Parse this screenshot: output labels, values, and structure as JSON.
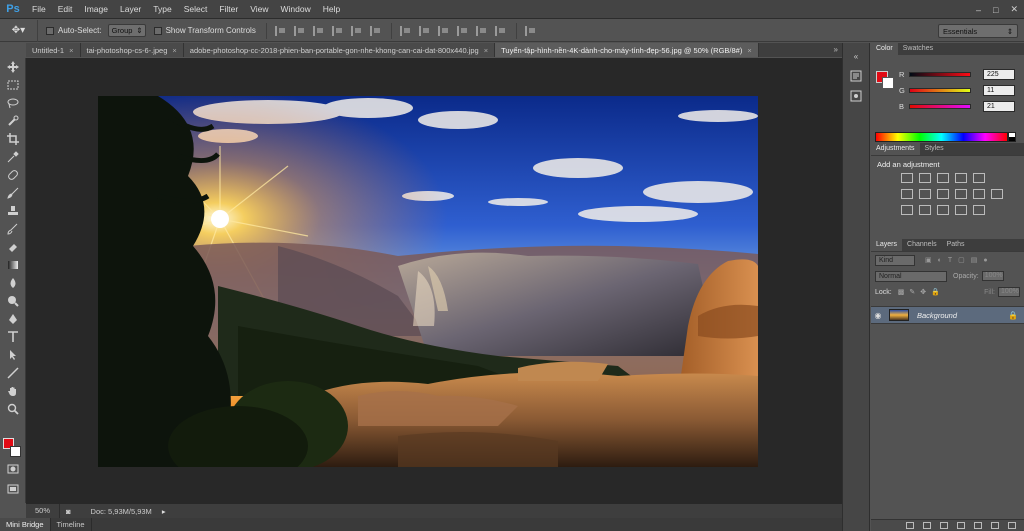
{
  "app": {
    "logo": "Ps"
  },
  "menu": [
    "File",
    "Edit",
    "Image",
    "Layer",
    "Type",
    "Select",
    "Filter",
    "View",
    "Window",
    "Help"
  ],
  "window_controls": [
    "–",
    "□",
    "✕"
  ],
  "options": {
    "auto_select_label": "Auto-Select:",
    "auto_select_value": "Group",
    "transform_label": "Show Transform Controls",
    "workspace": "Essentials"
  },
  "tabs": [
    {
      "label": "Untitled-1",
      "active": false
    },
    {
      "label": "tai-photoshop-cs-6-.jpeg",
      "active": false
    },
    {
      "label": "adobe-photoshop-cc-2018-phien-ban-portable-gon-nhe-khong-can-cai-dat-800x440.jpg",
      "active": false
    },
    {
      "label": "Tuyển-tập-hình-nền-4K-dành-cho-máy-tính-đẹp-56.jpg @ 50% (RGB/8#)",
      "active": true
    }
  ],
  "status": {
    "zoom": "50%",
    "doc": "Doc: 5,93M/5,93M"
  },
  "bottom_tabs": [
    "Mini Bridge",
    "Timeline"
  ],
  "color_panel": {
    "tabs": [
      "Color",
      "Swatches"
    ],
    "channels": [
      {
        "label": "R",
        "value": "225"
      },
      {
        "label": "G",
        "value": "11"
      },
      {
        "label": "B",
        "value": "21"
      }
    ],
    "foreground": "#e10b15",
    "background": "#ffffff"
  },
  "adjustments": {
    "tabs": [
      "Adjustments",
      "Styles"
    ],
    "title": "Add an adjustment"
  },
  "layers": {
    "tabs": [
      "Layers",
      "Channels",
      "Paths"
    ],
    "kind": "Kind",
    "blend": "Normal",
    "opacity_label": "Opacity:",
    "opacity": "100%",
    "lock_label": "Lock:",
    "fill_label": "Fill:",
    "fill": "100%",
    "layer_name": "Background"
  }
}
